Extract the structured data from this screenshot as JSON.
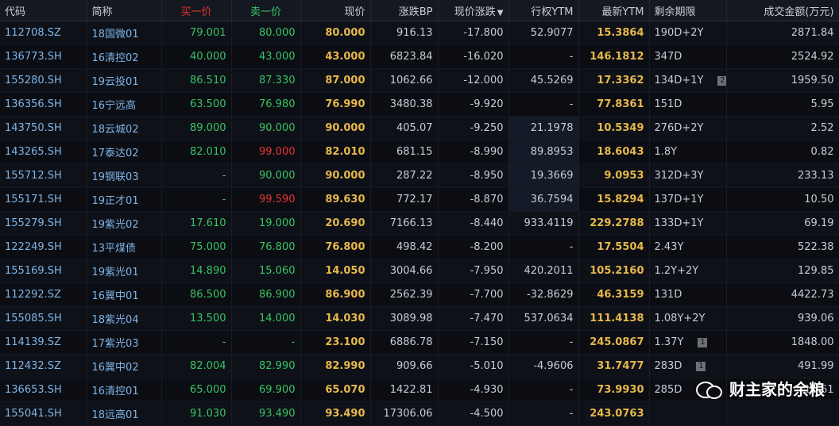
{
  "columns": {
    "code": "代码",
    "name": "简称",
    "bid": "买一价",
    "ask": "卖一价",
    "price": "现价",
    "bp": "涨跌BP",
    "chg": "现价涨跌",
    "ytm": "行权YTM",
    "lytm": "最新YTM",
    "term": "剩余期限",
    "amt": "成交金额(万元)"
  },
  "sort_indicator": "▼",
  "rows": [
    {
      "code": "112708.SZ",
      "name": "18国微01",
      "bid": "79.001",
      "ask": "80.000",
      "ask_red": false,
      "price": "80.000",
      "bp": "916.13",
      "chg": "-17.800",
      "ytm": "52.9077",
      "lytm": "15.3864",
      "term": "190D+2Y",
      "badge": "",
      "amt": "2871.84"
    },
    {
      "code": "136773.SH",
      "name": "16清控02",
      "bid": "40.000",
      "ask": "43.000",
      "ask_red": false,
      "price": "43.000",
      "bp": "6823.84",
      "chg": "-16.020",
      "ytm": "-",
      "lytm": "146.1812",
      "term": "347D",
      "badge": "",
      "amt": "2524.92"
    },
    {
      "code": "155280.SH",
      "name": "19云投01",
      "bid": "86.510",
      "ask": "87.330",
      "ask_red": false,
      "price": "87.000",
      "bp": "1062.66",
      "chg": "-12.000",
      "ytm": "45.5269",
      "lytm": "17.3362",
      "term": "134D+1Y",
      "badge": "2",
      "amt": "1959.50"
    },
    {
      "code": "136356.SH",
      "name": "16宁远高",
      "bid": "63.500",
      "ask": "76.980",
      "ask_red": false,
      "price": "76.990",
      "bp": "3480.38",
      "chg": "-9.920",
      "ytm": "-",
      "lytm": "77.8361",
      "term": "151D",
      "badge": "",
      "amt": "5.95"
    },
    {
      "code": "143750.SH",
      "name": "18云城02",
      "bid": "89.000",
      "ask": "90.000",
      "ask_red": false,
      "price": "90.000",
      "bp": "405.07",
      "chg": "-9.250",
      "ytm": "21.1978",
      "lytm": "10.5349",
      "term": "276D+2Y",
      "badge": "",
      "amt": "2.52"
    },
    {
      "code": "143265.SH",
      "name": "17泰达02",
      "bid": "82.010",
      "ask": "99.000",
      "ask_red": true,
      "price": "82.010",
      "bp": "681.15",
      "chg": "-8.990",
      "ytm": "89.8953",
      "lytm": "18.6043",
      "term": "1.8Y",
      "badge": "",
      "amt": "0.82"
    },
    {
      "code": "155712.SH",
      "name": "19钢联03",
      "bid": "-",
      "ask": "90.000",
      "ask_red": false,
      "price": "90.000",
      "bp": "287.22",
      "chg": "-8.950",
      "ytm": "19.3669",
      "lytm": "9.0953",
      "term": "312D+3Y",
      "badge": "",
      "amt": "233.13"
    },
    {
      "code": "155171.SH",
      "name": "19正才01",
      "bid": "-",
      "ask": "99.590",
      "ask_red": true,
      "price": "89.630",
      "bp": "772.17",
      "chg": "-8.870",
      "ytm": "36.7594",
      "lytm": "15.8294",
      "term": "137D+1Y",
      "badge": "",
      "amt": "10.50"
    },
    {
      "code": "155279.SH",
      "name": "19紫光02",
      "bid": "17.610",
      "ask": "19.000",
      "ask_red": false,
      "price": "20.690",
      "bp": "7166.13",
      "chg": "-8.440",
      "ytm": "933.4119",
      "lytm": "229.2788",
      "term": "133D+1Y",
      "badge": "",
      "amt": "69.19"
    },
    {
      "code": "122249.SH",
      "name": "13平煤债",
      "bid": "75.000",
      "ask": "76.800",
      "ask_red": false,
      "price": "76.800",
      "bp": "498.42",
      "chg": "-8.200",
      "ytm": "-",
      "lytm": "17.5504",
      "term": "2.43Y",
      "badge": "",
      "amt": "522.38"
    },
    {
      "code": "155169.SH",
      "name": "19紫光01",
      "bid": "14.890",
      "ask": "15.060",
      "ask_red": false,
      "price": "14.050",
      "bp": "3004.66",
      "chg": "-7.950",
      "ytm": "420.2011",
      "lytm": "105.2160",
      "term": "1.2Y+2Y",
      "badge": "",
      "amt": "129.85"
    },
    {
      "code": "112292.SZ",
      "name": "16冀中01",
      "bid": "86.500",
      "ask": "86.900",
      "ask_red": false,
      "price": "86.900",
      "bp": "2562.39",
      "chg": "-7.700",
      "ytm": "-32.8629",
      "lytm": "46.3159",
      "term": "131D",
      "badge": "",
      "amt": "4422.73"
    },
    {
      "code": "155085.SH",
      "name": "18紫光04",
      "bid": "13.500",
      "ask": "14.000",
      "ask_red": false,
      "price": "14.030",
      "bp": "3089.98",
      "chg": "-7.470",
      "ytm": "537.0634",
      "lytm": "111.4138",
      "term": "1.08Y+2Y",
      "badge": "",
      "amt": "939.06"
    },
    {
      "code": "114139.SZ",
      "name": "17紫光03",
      "bid": "-",
      "ask": "-",
      "ask_red": false,
      "price": "23.100",
      "bp": "6886.78",
      "chg": "-7.150",
      "ytm": "-",
      "lytm": "245.0867",
      "term": "1.37Y",
      "badge": "1",
      "amt": "1848.00"
    },
    {
      "code": "112432.SZ",
      "name": "16冀中02",
      "bid": "82.004",
      "ask": "82.990",
      "ask_red": false,
      "price": "82.990",
      "bp": "909.66",
      "chg": "-5.010",
      "ytm": "-4.9606",
      "lytm": "31.7477",
      "term": "283D",
      "badge": "1",
      "amt": "491.99"
    },
    {
      "code": "136653.SH",
      "name": "16清控01",
      "bid": "65.000",
      "ask": "69.900",
      "ask_red": false,
      "price": "65.070",
      "bp": "1422.81",
      "chg": "-4.930",
      "ytm": "-",
      "lytm": "73.9930",
      "term": "285D",
      "badge": "",
      "amt": "11.61"
    },
    {
      "code": "155041.SH",
      "name": "18远高01",
      "bid": "91.030",
      "ask": "93.490",
      "ask_red": false,
      "price": "93.490",
      "bp": "17306.06",
      "chg": "-4.500",
      "ytm": "-",
      "lytm": "243.0763",
      "term": "",
      "badge": "",
      "amt": ""
    }
  ],
  "watermark": "财主家的余粮"
}
